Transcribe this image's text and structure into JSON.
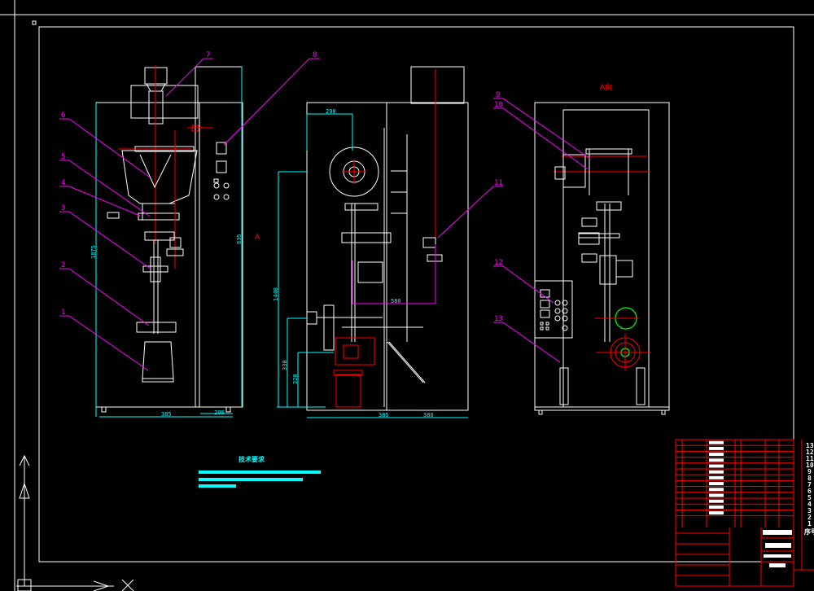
{
  "colors": {
    "background": "#000000",
    "outline": "#ffffff",
    "center_lines": "#ff0000",
    "dimensions": "#00ffff",
    "leaders": "#ff00ff",
    "highlight": "#00ff00"
  },
  "part_labels": [
    "1",
    "2",
    "3",
    "4",
    "5",
    "6",
    "7",
    "8",
    "9",
    "10",
    "11",
    "12",
    "13"
  ],
  "view_label": "A向",
  "section_marker": "A",
  "dimensions": {
    "left_height": "1875",
    "left_panel_height": "835",
    "left_width": "385",
    "left_panel_width": "200",
    "roll_offset": "290",
    "total_height": "1440",
    "shaft_offset": "580",
    "motor_height_1": "330",
    "motor_height_2": "320",
    "base_width_1": "385",
    "base_width_2": "380"
  },
  "tech_requirements": {
    "heading": "技术要求"
  },
  "side_column": [
    "13",
    "12",
    "11",
    "10",
    "9",
    "8",
    "7",
    "6",
    "5",
    "4",
    "3",
    "2",
    "1",
    "序号"
  ]
}
